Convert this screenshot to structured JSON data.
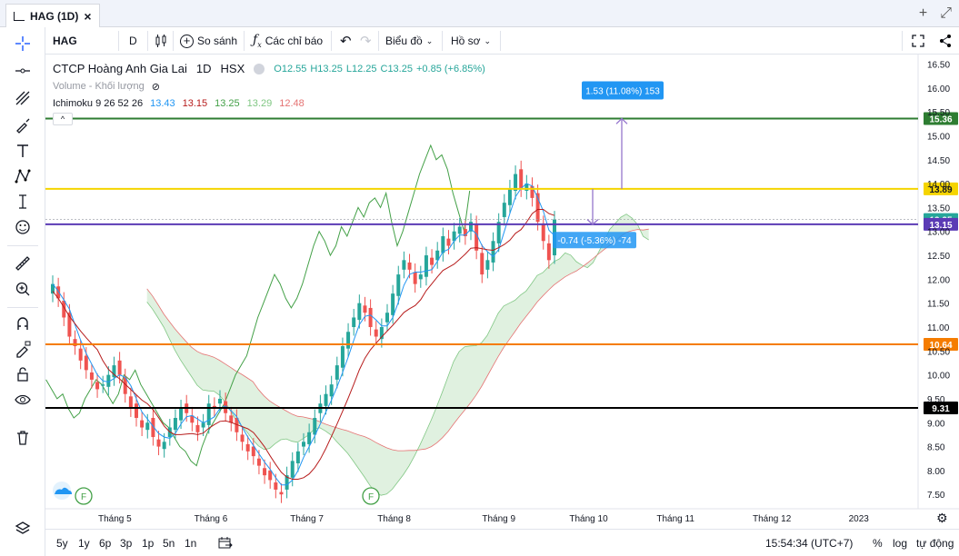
{
  "window": {
    "title": "HAG (1D)",
    "close_glyph": "×",
    "add_glyph": "+",
    "expand_glyph": "⤢"
  },
  "toolbar": {
    "symbol": "HAG",
    "interval": "D",
    "compare_label": "So sánh",
    "indicators_label": "Các chỉ báo",
    "chart_type_label": "Biểu đồ",
    "profile_label": "Hồ sơ"
  },
  "legend": {
    "name": "CTCP Hoàng Anh Gia Lai",
    "interval": "1D",
    "exchange": "HSX",
    "open": "O12.55",
    "high": "H13.25",
    "low": "L12.25",
    "close": "C13.25",
    "change": "+0.85 (+6.85%)",
    "volume_label": "Volume - Khối lượng",
    "ichimoku_label": "Ichimoku 9 26 52 26",
    "ichimoku_values": [
      "13.43",
      "13.15",
      "13.25",
      "13.29",
      "12.48"
    ]
  },
  "annotations": {
    "measure_up": "1.53 (11.08%) 153",
    "measure_down": "-0.74 (-5.36%) -74"
  },
  "price_axis": {
    "ticks": [
      "16.50",
      "16.00",
      "15.50",
      "15.00",
      "14.50",
      "14.00",
      "13.50",
      "13.00",
      "12.50",
      "12.00",
      "11.50",
      "11.00",
      "10.50",
      "10.00",
      "9.50",
      "9.00",
      "8.50",
      "8.00",
      "7.50"
    ],
    "badges": [
      {
        "label": "15.36",
        "value": 15.36,
        "color": "#2e7d32"
      },
      {
        "label": "13.89",
        "value": 13.89,
        "color": "#f5d400"
      },
      {
        "label": "13.25",
        "value": 13.25,
        "color": "#26a69a"
      },
      {
        "label": "13.15",
        "value": 13.15,
        "color": "#5b3bb5"
      },
      {
        "label": "10.64",
        "value": 10.64,
        "color": "#f57c00"
      },
      {
        "label": "9.31",
        "value": 9.31,
        "color": "#000000"
      }
    ]
  },
  "time_axis": [
    "Tháng 5",
    "Tháng 6",
    "Tháng 7",
    "Tháng 8",
    "Tháng 9",
    "Tháng 10",
    "Tháng 11",
    "Tháng 12",
    "2023"
  ],
  "chart_data": {
    "type": "candlestick",
    "symbol": "HAG",
    "horizontal_lines": [
      15.36,
      13.89,
      13.15,
      10.64,
      9.31
    ],
    "ylim": [
      7.2,
      16.7
    ],
    "close_path": [
      11.9,
      11.6,
      11.2,
      10.8,
      10.6,
      10.3,
      10.1,
      9.9,
      9.7,
      9.8,
      10.0,
      10.2,
      10.0,
      9.6,
      9.3,
      9.1,
      8.9,
      9.0,
      8.7,
      8.5,
      8.6,
      8.9,
      9.1,
      9.3,
      9.2,
      9.0,
      8.8,
      9.0,
      9.4,
      9.3,
      9.5,
      9.2,
      9.0,
      8.8,
      8.6,
      8.4,
      8.3,
      8.1,
      7.9,
      7.8,
      7.6,
      7.5,
      7.9,
      8.2,
      8.4,
      8.6,
      8.8,
      9.1,
      9.4,
      9.6,
      9.8,
      10.2,
      10.6,
      10.9,
      11.2,
      11.5,
      11.3,
      11.0,
      10.8,
      11.0,
      11.3,
      11.7,
      12.1,
      12.4,
      12.2,
      11.9,
      12.1,
      12.5,
      12.3,
      12.6,
      12.9,
      12.7,
      13.0,
      13.1,
      12.9,
      13.2,
      12.6,
      12.1,
      12.4,
      12.8,
      13.2,
      13.6,
      13.9,
      14.2,
      13.9,
      14.0,
      13.7,
      13.2,
      12.8,
      12.4,
      13.25
    ],
    "volume_label": "Volume - Khối lượng"
  },
  "bottom": {
    "ranges": [
      "5y",
      "1y",
      "6p",
      "3p",
      "1p",
      "5n",
      "1n"
    ],
    "clock": "15:54:34 (UTC+7)",
    "percent": "%",
    "log": "log",
    "auto": "tự động"
  },
  "colors": {
    "up": "#26a69a",
    "down": "#ef5350",
    "tenkan": "#2196f3",
    "kijun": "#b71c1c",
    "lagging": "#43a047",
    "cloud_up": "#a5d6a7",
    "cloud_down": "#ef9a9a",
    "measure": "#2196f3",
    "measure_line": "#9575cd"
  }
}
